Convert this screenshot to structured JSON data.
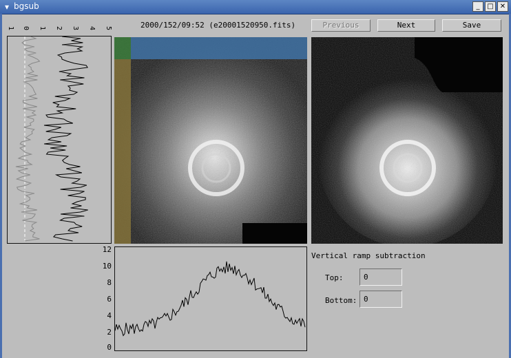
{
  "window": {
    "title": "bgsub",
    "minimize": "_",
    "maximize": "□",
    "close": "✕"
  },
  "header": {
    "filename": "2000/152/09:52 (e20001520950.fits)"
  },
  "buttons": {
    "previous": "Previous",
    "next": "Next",
    "save": "Save"
  },
  "left_plot": {
    "ticks": [
      "1",
      "0",
      "1",
      "2",
      "3",
      "4",
      "5"
    ]
  },
  "bottom_plot": {
    "ticks": [
      "12",
      "10",
      "8",
      "6",
      "4",
      "2",
      "0"
    ]
  },
  "ramp": {
    "heading": "Vertical ramp subtraction",
    "top_label": "Top:",
    "top_value": "0",
    "bottom_label": "Bottom:",
    "bottom_value": "0"
  }
}
